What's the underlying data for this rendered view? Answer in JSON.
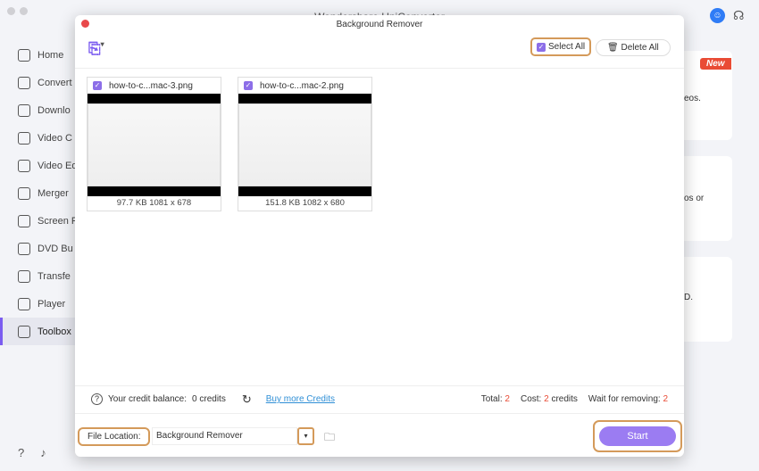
{
  "app": {
    "title": "Wondershare UniConverter"
  },
  "sidebar": {
    "items": [
      {
        "label": "Home"
      },
      {
        "label": "Convert"
      },
      {
        "label": "Downlo"
      },
      {
        "label": "Video C"
      },
      {
        "label": "Video Ed"
      },
      {
        "label": "Merger"
      },
      {
        "label": "Screen R"
      },
      {
        "label": "DVD Bu"
      },
      {
        "label": "Transfe"
      },
      {
        "label": "Player"
      },
      {
        "label": "Toolbox",
        "active": true
      }
    ]
  },
  "background": {
    "new_badge": "New",
    "card1_text": "eos.",
    "card2_text": "os or",
    "card3_text": "D."
  },
  "dialog": {
    "title": "Background Remover",
    "select_all": "Select All",
    "delete_all": "Delete All",
    "files": [
      {
        "name": "how-to-c...mac-3.png",
        "meta": "97.7 KB 1081 x 678"
      },
      {
        "name": "how-to-c...mac-2.png",
        "meta": "151.8 KB 1082 x 680"
      }
    ],
    "credit_label": "Your credit balance:",
    "credit_value": "0 credits",
    "buy_link": "Buy more Credits",
    "total_label": "Total:",
    "total": "2",
    "cost_label": "Cost:",
    "cost": "2",
    "cost_unit": "credits",
    "wait_label": "Wait for removing:",
    "wait": "2",
    "file_location_label": "File Location:",
    "file_location_value": "Background Remover",
    "start": "Start"
  },
  "colors": {
    "accent": "#9b7cf2",
    "highlight": "#d49a5a",
    "badge": "#e94b35"
  }
}
